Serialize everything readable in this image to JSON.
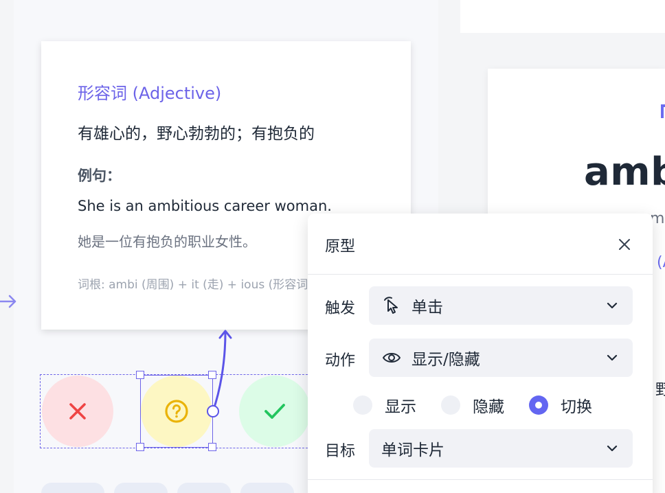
{
  "word_card": {
    "part_of_speech": "形容词 (Adjective)",
    "meaning": "有雄心的，野心勃勃的；有抱负的",
    "example_label": "例句：",
    "example_en": "She is an ambitious career woman.",
    "example_zh": "她是一位有抱负的职业女性。",
    "root": "词根: ambi (周围) + it (走) + ious (形容词后缀)"
  },
  "preview_card": {
    "word_fragment": "ambi",
    "phonetic_fragment": "m",
    "pos_fragment": "(A",
    "meaning_fragment": "野"
  },
  "answer_buttons": [
    {
      "name": "wrong",
      "symbol": "✕",
      "icon": "x-icon",
      "color": "#ef4444"
    },
    {
      "name": "unsure",
      "symbol": "?",
      "icon": "question-circle-icon",
      "color": "#eab308"
    },
    {
      "name": "correct",
      "symbol": "✓",
      "icon": "check-icon",
      "color": "#22c55e"
    }
  ],
  "prototype_panel": {
    "title": "原型",
    "trigger_label": "触发",
    "trigger_value": "单击",
    "trigger_icon": "pointer-click-icon",
    "action_label": "动作",
    "action_value": "显示/隐藏",
    "action_icon": "eye-icon",
    "visibility_options": [
      {
        "label": "显示",
        "checked": false
      },
      {
        "label": "隐藏",
        "checked": false
      },
      {
        "label": "切换",
        "checked": true
      }
    ],
    "target_label": "目标",
    "target_value": "单词卡片"
  },
  "colors": {
    "accent": "#6366f1",
    "wrong_bg": "#fde0e3",
    "unsure_bg": "#fdf7c3",
    "correct_bg": "#dcfce7"
  }
}
